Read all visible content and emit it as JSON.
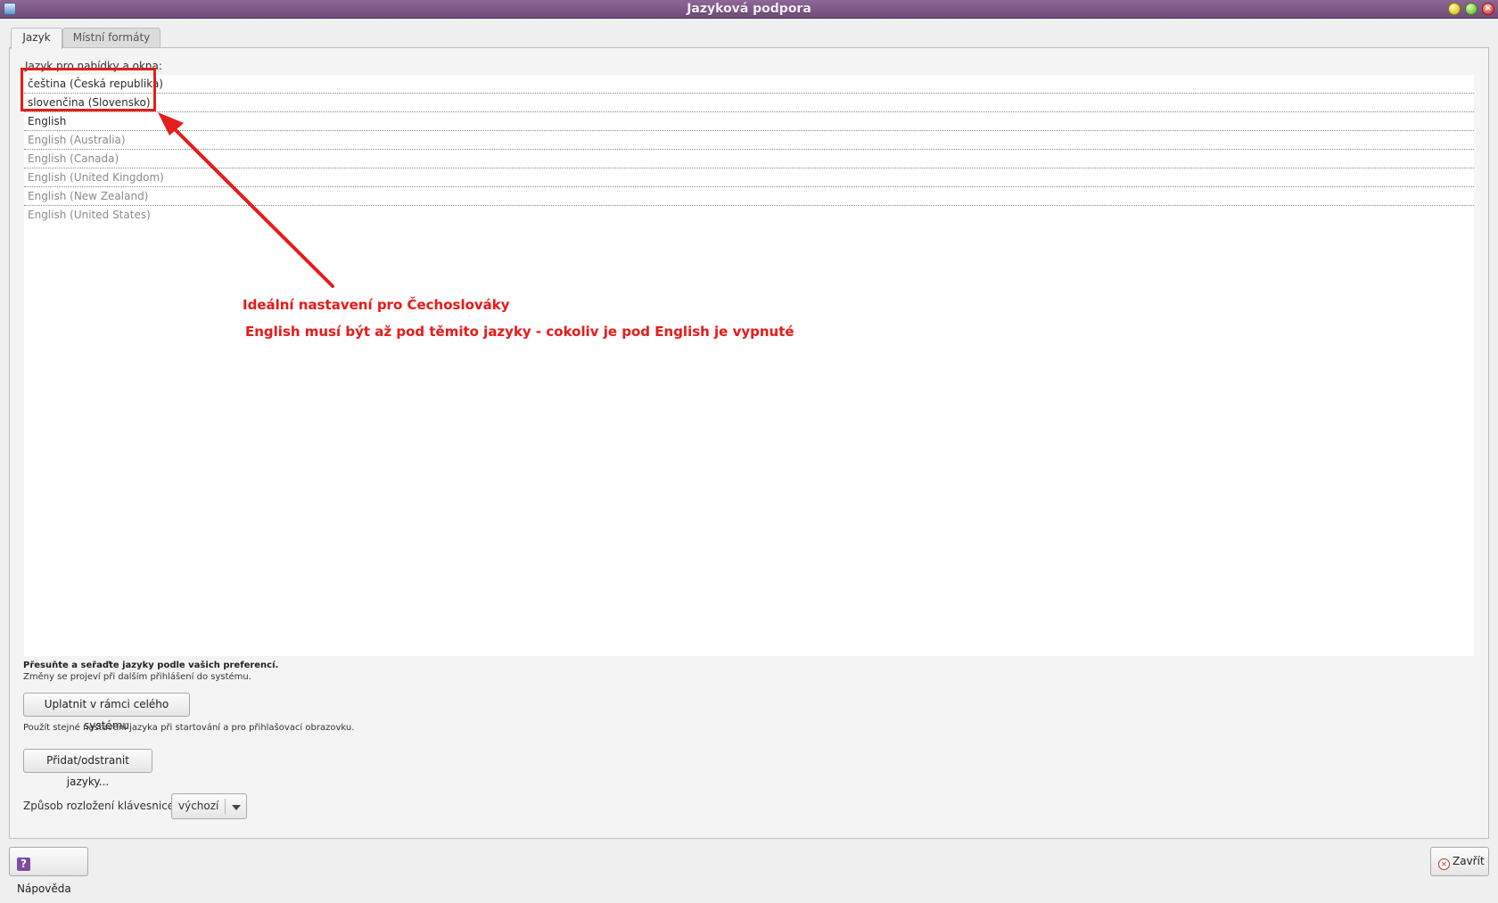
{
  "window": {
    "title": "Jazyková podpora"
  },
  "tabs": [
    {
      "label": "Jazyk",
      "active": true
    },
    {
      "label": "Místní formáty",
      "active": false
    }
  ],
  "language_section": {
    "label": "Jazyk pro nabídky a okna:",
    "items": [
      {
        "label": "čeština (Česká republika)",
        "enabled": true
      },
      {
        "label": "slovenčina (Slovensko)",
        "enabled": true
      },
      {
        "label": "English",
        "enabled": true
      },
      {
        "label": "English (Australia)",
        "enabled": false
      },
      {
        "label": "English (Canada)",
        "enabled": false
      },
      {
        "label": "English (United Kingdom)",
        "enabled": false
      },
      {
        "label": "English (New Zealand)",
        "enabled": false
      },
      {
        "label": "English (United States)",
        "enabled": false
      }
    ],
    "hint_strong": "Přesuňte a seřaďte jazyky podle vašich preferencí.",
    "hint_small": "Změny se projeví při dalším přihlášení do systému."
  },
  "actions": {
    "apply_system_wide": "Uplatnit v rámci celého systému",
    "apply_note": "Použít stejné nastavení jazyka při startování a pro přihlašovací obrazovku.",
    "add_remove_languages": "Přidat/odstranit jazyky..."
  },
  "keyboard": {
    "label": "Způsob rozložení klávesnice:",
    "selected": "výchozí"
  },
  "footer": {
    "help": "Nápověda",
    "close": "Zavřít"
  },
  "annotation": {
    "line1": "Ideální nastavení pro Čechoslováky",
    "line2": "English musí být až pod těmito jazyky - cokoliv je pod English je vypnuté",
    "color": "#e41d1d"
  },
  "theme": {
    "titlebar": "#7b5784",
    "window_bg": "#efefef",
    "list_bg": "#ffffff"
  }
}
